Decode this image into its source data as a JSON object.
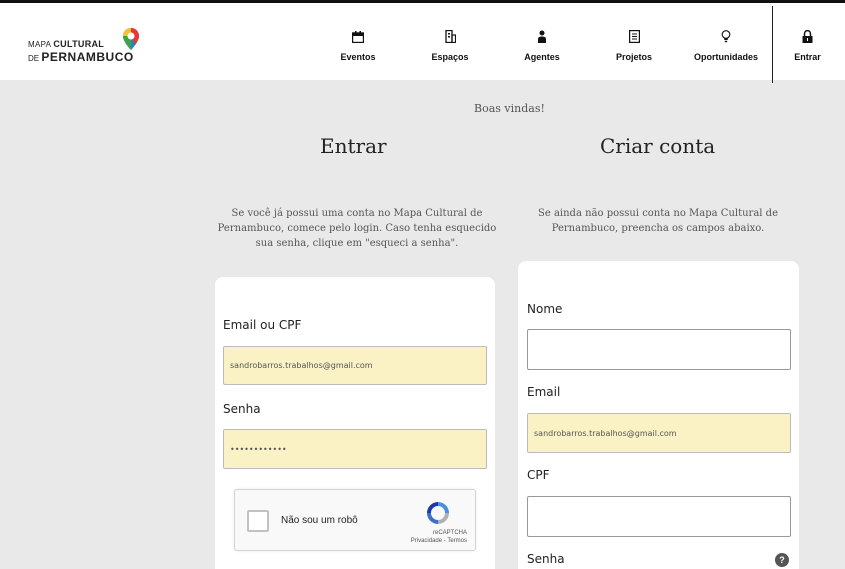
{
  "brand": {
    "line1_prefix": "MAPA",
    "line1_bold": "CULTURAL",
    "line2_prefix": "DE",
    "line2_bold": "PERNAMBUCO"
  },
  "nav": {
    "items": [
      {
        "label": "Eventos",
        "icon": "calendar-icon"
      },
      {
        "label": "Espaços",
        "icon": "building-icon"
      },
      {
        "label": "Agentes",
        "icon": "person-icon"
      },
      {
        "label": "Projetos",
        "icon": "document-icon"
      },
      {
        "label": "Oportunidades",
        "icon": "lightbulb-icon"
      },
      {
        "label": "Entrar",
        "icon": "lock-icon"
      }
    ]
  },
  "welcome": "Boas vindas!",
  "login": {
    "title": "Entrar",
    "description": "Se você já possui uma conta no Mapa Cultural de Pernambuco, comece pelo login. Caso tenha esquecido sua senha, clique em \"esqueci a senha\".",
    "email_label": "Email ou CPF",
    "email_value": "sandrobarros.trabalhos@gmail.com",
    "password_label": "Senha",
    "password_value": "••••••••••••",
    "captcha_label": "Não sou um robô",
    "captcha_brand": "reCAPTCHA",
    "captcha_links": "Privacidade - Termos"
  },
  "signup": {
    "title": "Criar conta",
    "description": "Se ainda não possui conta no Mapa Cultural de Pernambuco, preencha os campos abaixo.",
    "name_label": "Nome",
    "name_value": "",
    "email_label": "Email",
    "email_value": "sandrobarros.trabalhos@gmail.com",
    "cpf_label": "CPF",
    "cpf_value": "",
    "password_label": "Senha",
    "help": "?"
  }
}
